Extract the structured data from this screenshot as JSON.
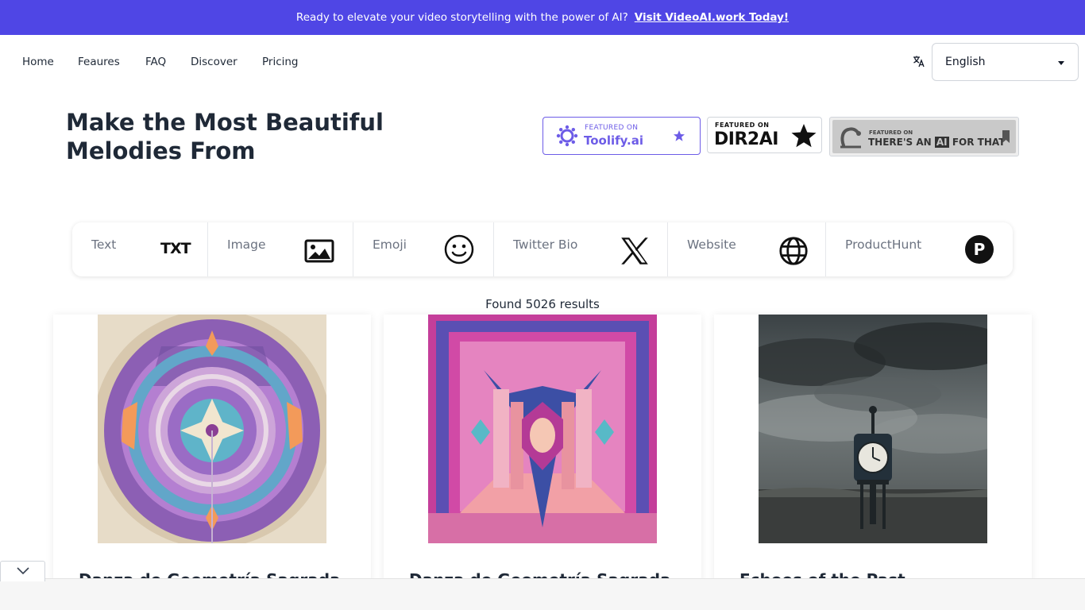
{
  "banner": {
    "text": "Ready to elevate your video storytelling with the power of AI?",
    "link": "Visit VideoAI.work Today!"
  },
  "nav": {
    "items": [
      "Home",
      "Feaures",
      "FAQ",
      "Discover",
      "Pricing"
    ]
  },
  "language": {
    "selected": "English"
  },
  "hero": {
    "title": "Make the Most Beautiful Melodies From"
  },
  "badges": {
    "toolify": {
      "small": "FEATURED ON",
      "name": "Toolify.ai"
    },
    "dir2ai": {
      "small": "FEATURED ON",
      "name": "DIR2AI"
    },
    "taaft": {
      "small": "FEATURED ON",
      "name_pre": "THERE'S AN",
      "name_ai": "AI",
      "name_post": "FOR THAT"
    }
  },
  "tabs": [
    {
      "label": "Text",
      "icon": "txt-icon"
    },
    {
      "label": "Image",
      "icon": "image-icon"
    },
    {
      "label": "Emoji",
      "icon": "smiley-icon"
    },
    {
      "label": "Twitter Bio",
      "icon": "x-logo-icon"
    },
    {
      "label": "Website",
      "icon": "globe-icon"
    },
    {
      "label": "ProductHunt",
      "icon": "producthunt-icon"
    }
  ],
  "tab_icon_text": {
    "txt": "TXT",
    "ph": "P"
  },
  "results": {
    "text": "Found 5026 results"
  },
  "cards": [
    {
      "title": "Danza de Geometría Sagrada"
    },
    {
      "title": "Danza de Geometría Sagrada"
    },
    {
      "title": "Echoes of the Past"
    }
  ],
  "colors": {
    "banner": "#4f46e5",
    "toolify_accent": "#6d5ce7"
  }
}
